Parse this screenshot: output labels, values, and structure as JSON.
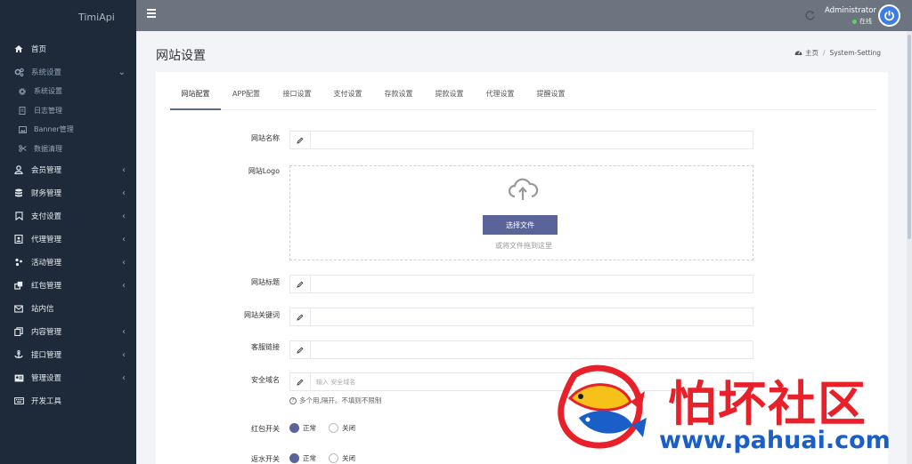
{
  "brand": "TimiApi",
  "sidebar": {
    "items": [
      {
        "label": "首页",
        "icon": "home-icon"
      },
      {
        "label": "系统设置",
        "icon": "gears-icon",
        "expanded": true
      },
      {
        "label": "会员管理",
        "icon": "user-icon"
      },
      {
        "label": "财务管理",
        "icon": "database-icon"
      },
      {
        "label": "支付设置",
        "icon": "bookmark-icon"
      },
      {
        "label": "代理管理",
        "icon": "contact-card-icon"
      },
      {
        "label": "活动管理",
        "icon": "activity-icon"
      },
      {
        "label": "红包管理",
        "icon": "clone-icon"
      },
      {
        "label": "站内信",
        "icon": "envelope-icon"
      },
      {
        "label": "内容管理",
        "icon": "copy-icon"
      },
      {
        "label": "接口管理",
        "icon": "anchor-icon"
      },
      {
        "label": "管理设置",
        "icon": "id-card-icon"
      },
      {
        "label": "开发工具",
        "icon": "keyboard-icon"
      }
    ],
    "sub_items": [
      {
        "label": "系统设置",
        "icon": "gear-icon"
      },
      {
        "label": "日志管理",
        "icon": "file-icon"
      },
      {
        "label": "Banner管理",
        "icon": "image-icon"
      },
      {
        "label": "数据清理",
        "icon": "scissors-icon"
      }
    ]
  },
  "header": {
    "user_name": "Administrator",
    "user_status": "在线"
  },
  "page": {
    "title": "网站设置",
    "breadcrumb": {
      "home": "主页",
      "current": "System-Setting"
    }
  },
  "tabs": [
    "网站配置",
    "APP配置",
    "接口设置",
    "支付设置",
    "存款设置",
    "提款设置",
    "代理设置",
    "提醒设置"
  ],
  "form": {
    "site_name_label": "网站名称",
    "site_name_value": "",
    "logo_label": "网站Logo",
    "upload_button": "选择文件",
    "upload_hint": "或将文件拖到这里",
    "site_title_label": "网站标题",
    "site_title_value": "",
    "keywords_label": "网站关键词",
    "keywords_value": "",
    "service_link_label": "客服链接",
    "service_link_value": "",
    "safe_domain_label": "安全域名",
    "safe_domain_placeholder": "输入 安全域名",
    "safe_domain_help": "多个用,隔开。不填则不限制",
    "redpack_label": "红包开关",
    "rebate_label": "返水开关",
    "option_normal": "正常",
    "option_off": "关闭"
  },
  "watermark": {
    "title": "怕坏社区",
    "url": "www.pahuai.com"
  },
  "colors": {
    "sidebar_bg": "#1e2a3a",
    "header_bg": "#6c7480",
    "accent": "#5b6499",
    "watermark_red": "#e8202a",
    "watermark_blue": "#1a5fc7"
  }
}
